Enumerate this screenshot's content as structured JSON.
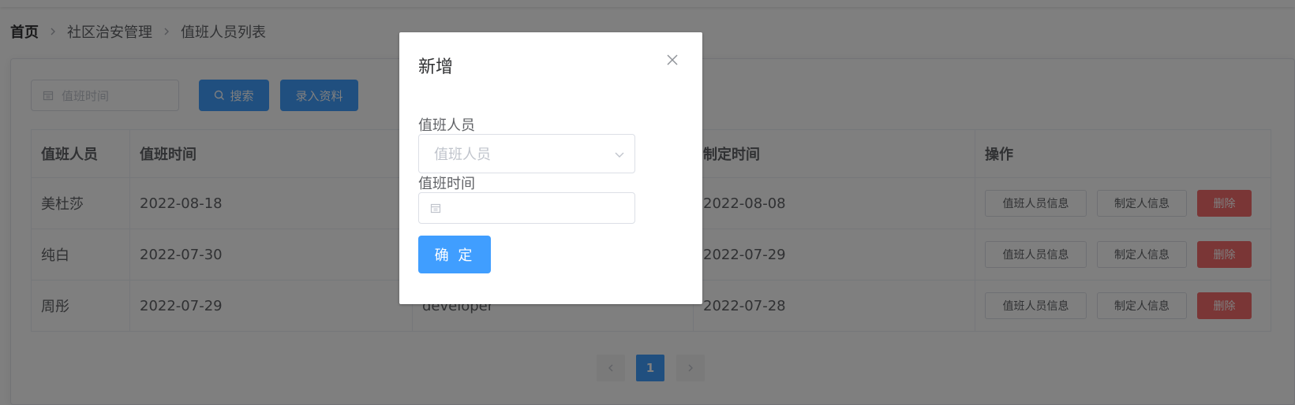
{
  "breadcrumb": {
    "home": "首页",
    "level1": "社区治安管理",
    "level2": "值班人员列表"
  },
  "toolbar": {
    "date_placeholder": "值班时间",
    "search_label": "搜索",
    "add_label": "录入资料"
  },
  "table": {
    "headers": [
      "值班人员",
      "值班时间",
      "",
      "制定时间",
      "操作"
    ],
    "rows": [
      {
        "person": "美杜莎",
        "duty_time": "2022-08-18",
        "creator": "",
        "created_time": "2022-08-08"
      },
      {
        "person": "纯白",
        "duty_time": "2022-07-30",
        "creator": "",
        "created_time": "2022-07-29"
      },
      {
        "person": "周彤",
        "duty_time": "2022-07-29",
        "creator": "developer",
        "created_time": "2022-07-28"
      }
    ],
    "actions": {
      "person_info": "值班人员信息",
      "creator_info": "制定人信息",
      "delete": "删除"
    }
  },
  "pagination": {
    "current_page": "1"
  },
  "dialog": {
    "title": "新增",
    "person_label": "值班人员",
    "person_placeholder": "值班人员",
    "time_label": "值班时间",
    "confirm_label": "确 定"
  },
  "colors": {
    "primary": "#409eff",
    "danger": "#f56c6c",
    "overlay": "rgba(0,0,0,0.5)"
  }
}
